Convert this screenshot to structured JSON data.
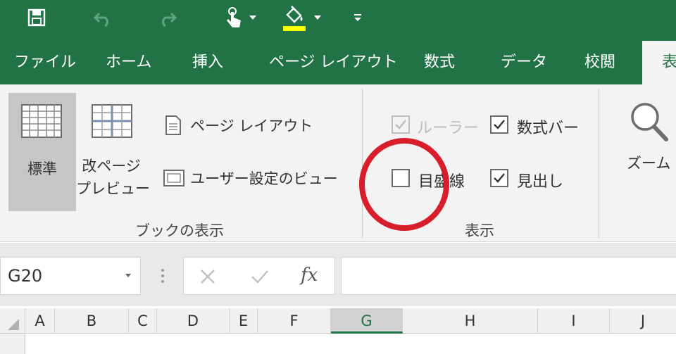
{
  "colors": {
    "excel_green": "#217346",
    "ribbon_bg": "#f3f3f3",
    "annotation_red": "#d81e2a"
  },
  "quick_access": {
    "icons": [
      "save-icon",
      "undo-icon",
      "redo-icon",
      "touch-mode-icon",
      "fill-color-icon",
      "customize-qat-icon"
    ]
  },
  "tabs": [
    {
      "label": "ファイル"
    },
    {
      "label": "ホーム"
    },
    {
      "label": "挿入"
    },
    {
      "label": "ページ レイアウト"
    },
    {
      "label": "数式"
    },
    {
      "label": "データ"
    },
    {
      "label": "校閲"
    },
    {
      "label": "表"
    }
  ],
  "ribbon": {
    "workbook_views": {
      "group_label": "ブックの表示",
      "normal": "標準",
      "page_break_line1": "改ページ",
      "page_break_line2": "プレビュー",
      "page_layout": "ページ レイアウト",
      "custom_views": "ユーザー設定のビュー"
    },
    "show": {
      "group_label": "表示",
      "ruler": {
        "label": "ルーラー",
        "checked": true,
        "disabled": true
      },
      "formula_bar": {
        "label": "数式バー",
        "checked": true
      },
      "gridlines": {
        "label": "目盛線",
        "checked": false
      },
      "headings": {
        "label": "見出し",
        "checked": true
      }
    },
    "zoom": {
      "label": "ズーム"
    }
  },
  "formula_bar": {
    "name_box": "G20",
    "cancel_icon": "close-icon",
    "enter_icon": "check-icon",
    "fx": "fx",
    "value": ""
  },
  "grid": {
    "columns": [
      "A",
      "B",
      "C",
      "D",
      "E",
      "F",
      "G",
      "H",
      "I",
      "J"
    ],
    "selected_column": "G"
  }
}
